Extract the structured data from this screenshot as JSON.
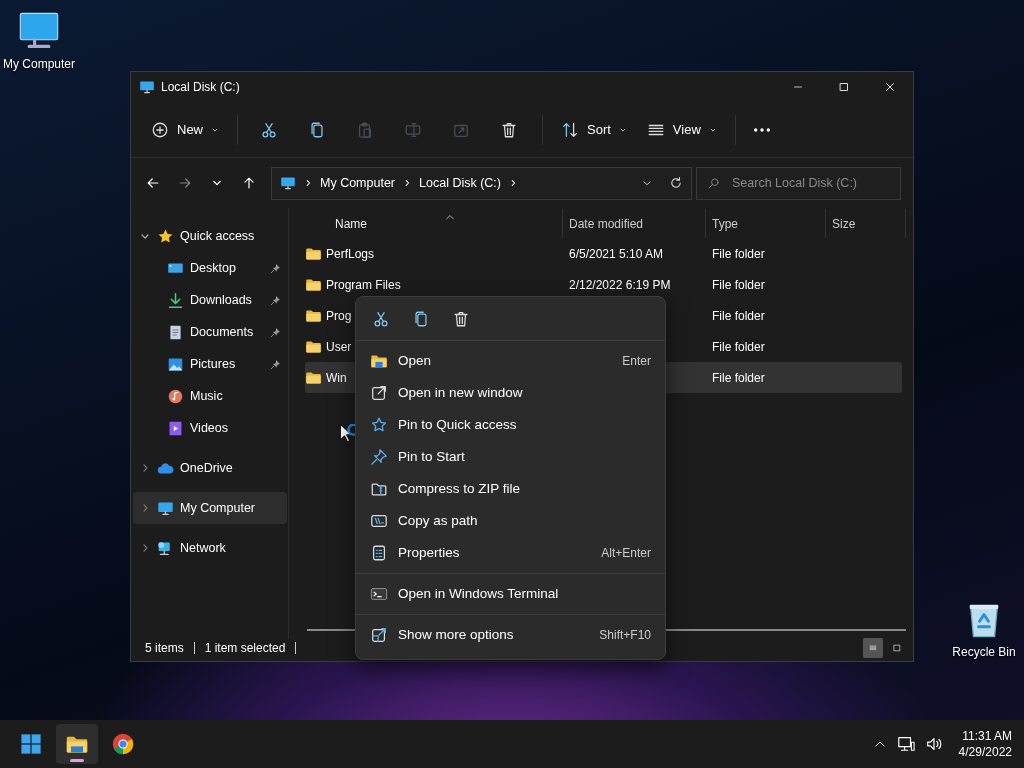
{
  "desktop_icons": [
    {
      "kind": "computer",
      "label": "My Computer"
    },
    {
      "kind": "recycle",
      "label": "Recycle Bin"
    }
  ],
  "window": {
    "title": "Local Disk (C:)"
  },
  "toolbar": [
    {
      "kind": "new",
      "label": "New",
      "disabled": false
    },
    {
      "kind": "cut",
      "disabled": false
    },
    {
      "kind": "copy",
      "disabled": false
    },
    {
      "kind": "paste",
      "disabled": true
    },
    {
      "kind": "rename",
      "disabled": true
    },
    {
      "kind": "share",
      "disabled": true
    },
    {
      "kind": "delete",
      "disabled": false
    },
    {
      "kind": "sort",
      "label": "Sort",
      "disabled": false
    },
    {
      "kind": "view",
      "label": "View",
      "disabled": false
    },
    {
      "kind": "more",
      "disabled": false
    }
  ],
  "nav": [
    {
      "kind": "back",
      "disabled": false
    },
    {
      "kind": "forward",
      "disabled": true
    },
    {
      "kind": "recent",
      "disabled": false
    },
    {
      "kind": "up",
      "disabled": false
    }
  ],
  "address": {
    "breadcrumbs": [
      "My Computer",
      "Local Disk (C:)"
    ]
  },
  "search": {
    "placeholder": "Search Local Disk (C:)"
  },
  "sidebar": {
    "items": [
      {
        "kind": "quick",
        "label": "Quick access",
        "expanded": true,
        "selected": false,
        "children": [
          {
            "kind": "desktop",
            "label": "Desktop",
            "pinned": true,
            "selected": false
          },
          {
            "kind": "downloads",
            "label": "Downloads",
            "pinned": true,
            "selected": false
          },
          {
            "kind": "documents",
            "label": "Documents",
            "pinned": true,
            "selected": false
          },
          {
            "kind": "pictures",
            "label": "Pictures",
            "pinned": true,
            "selected": false
          },
          {
            "kind": "music",
            "label": "Music",
            "pinned": false,
            "selected": false
          },
          {
            "kind": "videos",
            "label": "Videos",
            "pinned": false,
            "selected": false
          }
        ]
      },
      {
        "kind": "onedrive",
        "label": "OneDrive",
        "expanded": false,
        "selected": false
      },
      {
        "kind": "computer",
        "label": "My Computer",
        "expanded": false,
        "selected": true
      },
      {
        "kind": "network",
        "label": "Network",
        "expanded": false,
        "selected": false
      }
    ]
  },
  "table": {
    "columns": [
      {
        "label": "Name",
        "sorted": true
      },
      {
        "label": "Date modified",
        "sorted": false
      },
      {
        "label": "Type",
        "sorted": false
      },
      {
        "label": "Size",
        "sorted": false
      }
    ],
    "rows": [
      {
        "name": "PerfLogs",
        "date": "6/5/2021 5:10 AM",
        "type": "File folder",
        "selected": false
      },
      {
        "name": "Program Files",
        "date": "2/12/2022 6:19 PM",
        "type": "File folder",
        "selected": false
      },
      {
        "name": "Prog",
        "type": "File folder",
        "selected": false
      },
      {
        "name": "User",
        "type": "File folder",
        "selected": false
      },
      {
        "name": "Win",
        "type": "File folder",
        "selected": true
      }
    ]
  },
  "status_bar": {
    "items": "5 items",
    "selection": "1 item selected"
  },
  "view_modes": [
    {
      "kind": "details",
      "selected": true
    },
    {
      "kind": "tiles",
      "selected": false
    }
  ],
  "context_menu": {
    "quick_actions": [
      {
        "kind": "cut"
      },
      {
        "kind": "copy"
      },
      {
        "kind": "delete"
      }
    ],
    "sections": [
      [
        {
          "kind": "open",
          "label": "Open",
          "shortcut": "Enter"
        },
        {
          "kind": "newwin",
          "label": "Open in new window"
        },
        {
          "kind": "pinquick",
          "label": "Pin to Quick access"
        },
        {
          "kind": "pinstart",
          "label": "Pin to Start"
        },
        {
          "kind": "zip",
          "label": "Compress to ZIP file"
        },
        {
          "kind": "path",
          "label": "Copy as path"
        },
        {
          "kind": "props",
          "label": "Properties",
          "shortcut": "Alt+Enter"
        }
      ],
      [
        {
          "kind": "terminal",
          "label": "Open in Windows Terminal"
        }
      ],
      [
        {
          "kind": "moreopts",
          "label": "Show more options",
          "shortcut": "Shift+F10"
        }
      ]
    ]
  },
  "taskbar": {
    "apps": [
      {
        "kind": "start",
        "active": false
      },
      {
        "kind": "explorer",
        "active": true
      },
      {
        "kind": "browser",
        "active": false
      }
    ],
    "time": "11:31 AM",
    "date": "4/29/2022"
  }
}
